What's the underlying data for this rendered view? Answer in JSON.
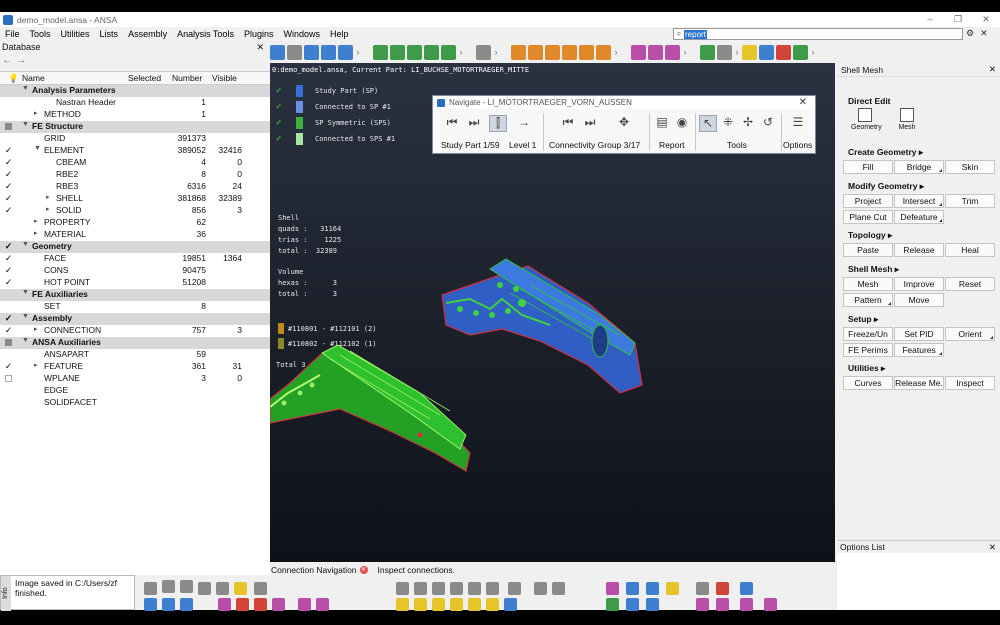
{
  "window": {
    "title": "demo_model.ansa - ANSA",
    "controls": [
      "–",
      "❐",
      "✕"
    ]
  },
  "menu": [
    "File",
    "Tools",
    "Utilities",
    "Lists",
    "Assembly",
    "Analysis Tools",
    "Plugins",
    "Windows",
    "Help"
  ],
  "search": {
    "value": "report"
  },
  "database": {
    "title": "Database",
    "columns": [
      "Name",
      "Selected",
      "Number",
      "Visible"
    ],
    "rows": [
      {
        "type": "cat",
        "indent": 0,
        "name": "Analysis Parameters",
        "check": "",
        "selected": "",
        "number": "",
        "visible": "",
        "tw": "▼"
      },
      {
        "type": "item",
        "indent": 2,
        "name": "Nastran Header",
        "check": "",
        "selected": "",
        "number": "1",
        "visible": "",
        "tw": ""
      },
      {
        "type": "item",
        "indent": 1,
        "name": "METHOD",
        "check": "",
        "selected": "",
        "number": "1",
        "visible": "",
        "tw": "▸"
      },
      {
        "type": "cat",
        "indent": 0,
        "name": "FE Structure",
        "check": "sq",
        "selected": "",
        "number": "",
        "visible": "",
        "tw": "▼"
      },
      {
        "type": "item",
        "indent": 1,
        "name": "GRID",
        "check": "",
        "selected": "",
        "number": "391373",
        "visible": "",
        "tw": ""
      },
      {
        "type": "item",
        "indent": 1,
        "name": "ELEMENT",
        "check": "✓",
        "selected": "",
        "number": "389052",
        "visible": "32416",
        "tw": "▼"
      },
      {
        "type": "item",
        "indent": 2,
        "name": "CBEAM",
        "check": "✓",
        "selected": "",
        "number": "4",
        "visible": "0",
        "tw": ""
      },
      {
        "type": "item",
        "indent": 2,
        "name": "RBE2",
        "check": "✓",
        "selected": "",
        "number": "8",
        "visible": "0",
        "tw": ""
      },
      {
        "type": "item",
        "indent": 2,
        "name": "RBE3",
        "check": "✓",
        "selected": "",
        "number": "6316",
        "visible": "24",
        "tw": ""
      },
      {
        "type": "item",
        "indent": 2,
        "name": "SHELL",
        "check": "✓",
        "selected": "",
        "number": "381868",
        "visible": "32389",
        "tw": "▸"
      },
      {
        "type": "item",
        "indent": 2,
        "name": "SOLID",
        "check": "✓",
        "selected": "",
        "number": "856",
        "visible": "3",
        "tw": "▸"
      },
      {
        "type": "item",
        "indent": 1,
        "name": "PROPERTY",
        "check": "",
        "selected": "",
        "number": "62",
        "visible": "",
        "tw": "▸"
      },
      {
        "type": "item",
        "indent": 1,
        "name": "MATERIAL",
        "check": "",
        "selected": "",
        "number": "36",
        "visible": "",
        "tw": "▸"
      },
      {
        "type": "cat",
        "indent": 0,
        "name": "Geometry",
        "check": "✓",
        "selected": "",
        "number": "",
        "visible": "",
        "tw": "▼"
      },
      {
        "type": "item",
        "indent": 1,
        "name": "FACE",
        "check": "✓",
        "selected": "",
        "number": "19851",
        "visible": "1364",
        "tw": ""
      },
      {
        "type": "item",
        "indent": 1,
        "name": "CONS",
        "check": "✓",
        "selected": "",
        "number": "90475",
        "visible": "",
        "tw": ""
      },
      {
        "type": "item",
        "indent": 1,
        "name": "HOT POINT",
        "check": "✓",
        "selected": "",
        "number": "51208",
        "visible": "",
        "tw": ""
      },
      {
        "type": "cat",
        "indent": 0,
        "name": "FE Auxiliaries",
        "check": "",
        "selected": "",
        "number": "",
        "visible": "",
        "tw": "▼"
      },
      {
        "type": "item",
        "indent": 1,
        "name": "SET",
        "check": "",
        "selected": "",
        "number": "8",
        "visible": "",
        "tw": ""
      },
      {
        "type": "cat",
        "indent": 0,
        "name": "Assembly",
        "check": "✓",
        "selected": "",
        "number": "",
        "visible": "",
        "tw": "▼"
      },
      {
        "type": "item",
        "indent": 1,
        "name": "CONNECTION",
        "check": "✓",
        "selected": "",
        "number": "757",
        "visible": "3",
        "tw": "▸"
      },
      {
        "type": "cat",
        "indent": 0,
        "name": "ANSA Auxiliaries",
        "check": "sq",
        "selected": "",
        "number": "",
        "visible": "",
        "tw": "▼"
      },
      {
        "type": "item",
        "indent": 1,
        "name": "ANSAPART",
        "check": "",
        "selected": "",
        "number": "59",
        "visible": "",
        "tw": ""
      },
      {
        "type": "item",
        "indent": 1,
        "name": "FEATURE",
        "check": "✓",
        "selected": "",
        "number": "361",
        "visible": "31",
        "tw": "▸"
      },
      {
        "type": "item",
        "indent": 1,
        "name": "WPLANE",
        "check": "empty",
        "selected": "",
        "number": "3",
        "visible": "0",
        "tw": ""
      },
      {
        "type": "item",
        "indent": 1,
        "name": "EDGE",
        "check": "",
        "selected": "",
        "number": "",
        "visible": "",
        "tw": ""
      },
      {
        "type": "item",
        "indent": 1,
        "name": "SOLIDFACET",
        "check": "",
        "selected": "",
        "number": "",
        "visible": "",
        "tw": ""
      }
    ]
  },
  "messages": {
    "tab": "Info",
    "line1": "Image saved in C:/Users/zf",
    "line2": "finished."
  },
  "viewport": {
    "header": "0:demo_model.ansa,  Current Part: LI_BUCHSE_MOTORTRAEGER_MITTE",
    "legend": [
      {
        "label": "Study Part (SP)",
        "color": "#3a6fd8"
      },
      {
        "label": "Connected to SP #1",
        "color": "#6a8fe0"
      },
      {
        "label": "SP Symmetric (SPS)",
        "color": "#3db33d"
      },
      {
        "label": "Connected to SPS #1",
        "color": "#a8e6a0"
      }
    ],
    "shell_title": "Shell",
    "quads": "quads :   31164",
    "trias": "trias :    1225",
    "shell_total": "total :  32389",
    "volume_title": "Volume",
    "hexas": "hexas :      3",
    "volume_total": "total :      3",
    "ranges": [
      {
        "label": "#110801 - #112101 (2)",
        "color": "#c08a1a"
      },
      {
        "label": "#110802 - #112102 (1)",
        "color": "#8a8a2a"
      }
    ],
    "grand_total": "Total 3"
  },
  "navigate": {
    "title": "Navigate - LI_MOTORTRAEGER_VORN_AUSSEN",
    "study_part": "Study Part 1/59",
    "level": "Level 1",
    "connectivity": "Connectivity Group 3/17",
    "report": "Report",
    "tools": "Tools",
    "options": "Options"
  },
  "status": {
    "conn_nav": "Connection Navigation",
    "hint": "Inspect connections."
  },
  "right_panel": {
    "title": "Shell Mesh",
    "direct_edit": "Direct Edit",
    "geometry_btn": "Geometry",
    "mesh_btn": "Mesh",
    "create_geometry": "Create Geometry ▸",
    "cg_buttons": [
      "Fill",
      "Bridge",
      "Skin"
    ],
    "modify_geometry": "Modify Geometry ▸",
    "mg_buttons": [
      "Project",
      "Intersect",
      "Trim",
      "Plane Cut",
      "Defeature"
    ],
    "topology": "Topology ▸",
    "topo_buttons": [
      "Paste",
      "Release",
      "Heal"
    ],
    "shell_mesh": "Shell Mesh ▸",
    "sm_buttons": [
      "Mesh",
      "Improve",
      "Reset",
      "Pattern",
      "Move"
    ],
    "setup": "Setup ▸",
    "setup_buttons": [
      "Freeze/Un",
      "Set PID",
      "Orient",
      "FE Perims",
      "Features"
    ],
    "utilities": "Utilities ▸",
    "util_buttons": [
      "Curves",
      "Release Me.",
      "Inspect"
    ],
    "options_list": "Options List"
  }
}
